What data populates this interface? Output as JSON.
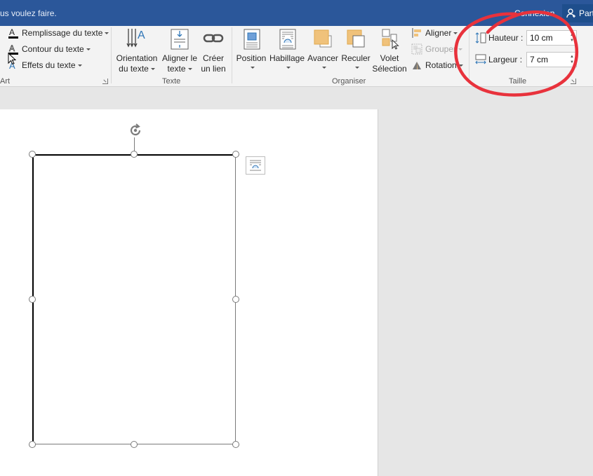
{
  "titlebar": {
    "tell_me": "us voulez faire.",
    "connexion": "Connexion",
    "share": "Part"
  },
  "ribbon": {
    "wordart": {
      "items": [
        {
          "label": "Remplissage du texte",
          "icon": "text-fill-icon",
          "color": "#000000"
        },
        {
          "label": "Contour du texte",
          "icon": "text-outline-icon",
          "color": "#000000"
        },
        {
          "label": "Effets du texte",
          "icon": "text-effects-icon",
          "color": "#2e75b6"
        }
      ],
      "group_label": "Art"
    },
    "texte": {
      "buttons": [
        {
          "label1": "Orientation",
          "label2": "du texte",
          "icon": "text-direction-icon"
        },
        {
          "label1": "Aligner le",
          "label2": "texte",
          "icon": "align-text-icon"
        },
        {
          "label1": "Créer",
          "label2": "un lien",
          "icon": "link-icon"
        }
      ],
      "group_label": "Texte"
    },
    "organiser": {
      "buttons": [
        {
          "label1": "Position",
          "icon": "position-icon"
        },
        {
          "label1": "Habillage",
          "icon": "wrap-text-icon"
        },
        {
          "label1": "Avancer",
          "icon": "bring-forward-icon"
        },
        {
          "label1": "Reculer",
          "icon": "send-backward-icon"
        },
        {
          "label1": "Volet",
          "label2": "Sélection",
          "icon": "selection-pane-icon"
        }
      ],
      "small": [
        {
          "label": "Aligner",
          "icon": "align-icon",
          "disabled": false
        },
        {
          "label": "Grouper",
          "icon": "group-icon",
          "disabled": true
        },
        {
          "label": "Rotation",
          "icon": "rotate-icon",
          "disabled": false
        }
      ],
      "group_label": "Organiser"
    },
    "taille": {
      "hauteur_label": "Hauteur :",
      "hauteur_value": "10 cm",
      "largeur_label": "Largeur :",
      "largeur_value": "7 cm",
      "group_label": "Taille"
    }
  },
  "colors": {
    "titlebar": "#2b579a",
    "accent_shape": "#f0c27b",
    "annotation": "#e8323c"
  }
}
